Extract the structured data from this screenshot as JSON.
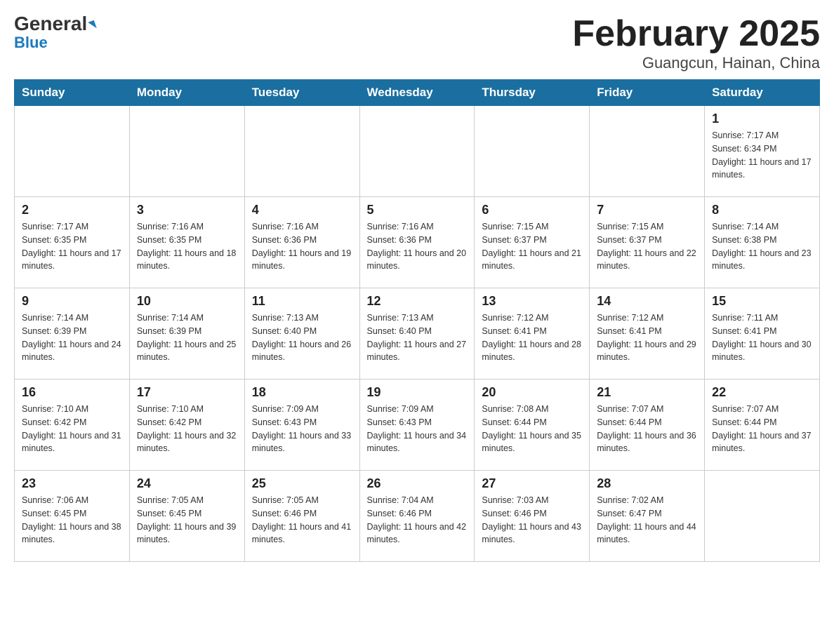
{
  "header": {
    "logo_general": "General",
    "logo_blue": "Blue",
    "month_title": "February 2025",
    "location": "Guangcun, Hainan, China"
  },
  "days_of_week": [
    "Sunday",
    "Monday",
    "Tuesday",
    "Wednesday",
    "Thursday",
    "Friday",
    "Saturday"
  ],
  "weeks": [
    [
      {
        "day": "",
        "info": ""
      },
      {
        "day": "",
        "info": ""
      },
      {
        "day": "",
        "info": ""
      },
      {
        "day": "",
        "info": ""
      },
      {
        "day": "",
        "info": ""
      },
      {
        "day": "",
        "info": ""
      },
      {
        "day": "1",
        "info": "Sunrise: 7:17 AM\nSunset: 6:34 PM\nDaylight: 11 hours and 17 minutes."
      }
    ],
    [
      {
        "day": "2",
        "info": "Sunrise: 7:17 AM\nSunset: 6:35 PM\nDaylight: 11 hours and 17 minutes."
      },
      {
        "day": "3",
        "info": "Sunrise: 7:16 AM\nSunset: 6:35 PM\nDaylight: 11 hours and 18 minutes."
      },
      {
        "day": "4",
        "info": "Sunrise: 7:16 AM\nSunset: 6:36 PM\nDaylight: 11 hours and 19 minutes."
      },
      {
        "day": "5",
        "info": "Sunrise: 7:16 AM\nSunset: 6:36 PM\nDaylight: 11 hours and 20 minutes."
      },
      {
        "day": "6",
        "info": "Sunrise: 7:15 AM\nSunset: 6:37 PM\nDaylight: 11 hours and 21 minutes."
      },
      {
        "day": "7",
        "info": "Sunrise: 7:15 AM\nSunset: 6:37 PM\nDaylight: 11 hours and 22 minutes."
      },
      {
        "day": "8",
        "info": "Sunrise: 7:14 AM\nSunset: 6:38 PM\nDaylight: 11 hours and 23 minutes."
      }
    ],
    [
      {
        "day": "9",
        "info": "Sunrise: 7:14 AM\nSunset: 6:39 PM\nDaylight: 11 hours and 24 minutes."
      },
      {
        "day": "10",
        "info": "Sunrise: 7:14 AM\nSunset: 6:39 PM\nDaylight: 11 hours and 25 minutes."
      },
      {
        "day": "11",
        "info": "Sunrise: 7:13 AM\nSunset: 6:40 PM\nDaylight: 11 hours and 26 minutes."
      },
      {
        "day": "12",
        "info": "Sunrise: 7:13 AM\nSunset: 6:40 PM\nDaylight: 11 hours and 27 minutes."
      },
      {
        "day": "13",
        "info": "Sunrise: 7:12 AM\nSunset: 6:41 PM\nDaylight: 11 hours and 28 minutes."
      },
      {
        "day": "14",
        "info": "Sunrise: 7:12 AM\nSunset: 6:41 PM\nDaylight: 11 hours and 29 minutes."
      },
      {
        "day": "15",
        "info": "Sunrise: 7:11 AM\nSunset: 6:41 PM\nDaylight: 11 hours and 30 minutes."
      }
    ],
    [
      {
        "day": "16",
        "info": "Sunrise: 7:10 AM\nSunset: 6:42 PM\nDaylight: 11 hours and 31 minutes."
      },
      {
        "day": "17",
        "info": "Sunrise: 7:10 AM\nSunset: 6:42 PM\nDaylight: 11 hours and 32 minutes."
      },
      {
        "day": "18",
        "info": "Sunrise: 7:09 AM\nSunset: 6:43 PM\nDaylight: 11 hours and 33 minutes."
      },
      {
        "day": "19",
        "info": "Sunrise: 7:09 AM\nSunset: 6:43 PM\nDaylight: 11 hours and 34 minutes."
      },
      {
        "day": "20",
        "info": "Sunrise: 7:08 AM\nSunset: 6:44 PM\nDaylight: 11 hours and 35 minutes."
      },
      {
        "day": "21",
        "info": "Sunrise: 7:07 AM\nSunset: 6:44 PM\nDaylight: 11 hours and 36 minutes."
      },
      {
        "day": "22",
        "info": "Sunrise: 7:07 AM\nSunset: 6:44 PM\nDaylight: 11 hours and 37 minutes."
      }
    ],
    [
      {
        "day": "23",
        "info": "Sunrise: 7:06 AM\nSunset: 6:45 PM\nDaylight: 11 hours and 38 minutes."
      },
      {
        "day": "24",
        "info": "Sunrise: 7:05 AM\nSunset: 6:45 PM\nDaylight: 11 hours and 39 minutes."
      },
      {
        "day": "25",
        "info": "Sunrise: 7:05 AM\nSunset: 6:46 PM\nDaylight: 11 hours and 41 minutes."
      },
      {
        "day": "26",
        "info": "Sunrise: 7:04 AM\nSunset: 6:46 PM\nDaylight: 11 hours and 42 minutes."
      },
      {
        "day": "27",
        "info": "Sunrise: 7:03 AM\nSunset: 6:46 PM\nDaylight: 11 hours and 43 minutes."
      },
      {
        "day": "28",
        "info": "Sunrise: 7:02 AM\nSunset: 6:47 PM\nDaylight: 11 hours and 44 minutes."
      },
      {
        "day": "",
        "info": ""
      }
    ]
  ]
}
